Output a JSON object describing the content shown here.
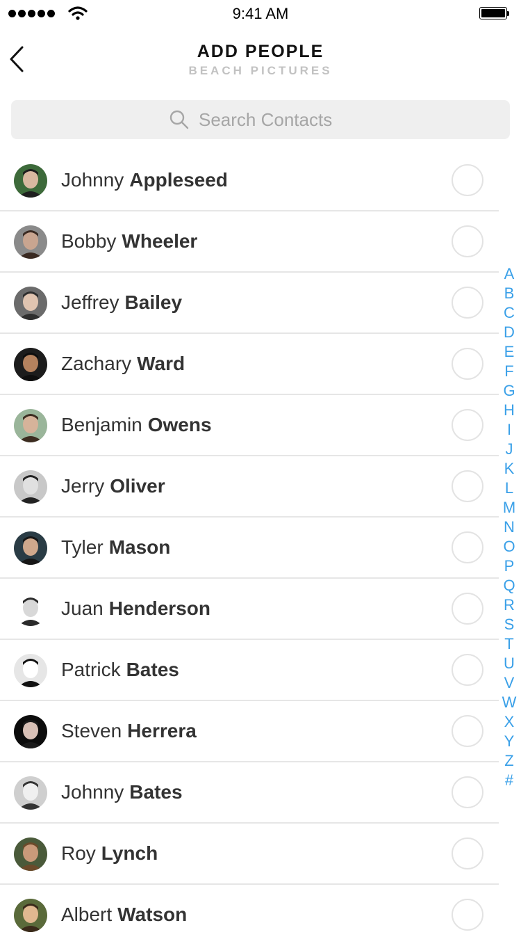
{
  "status_bar": {
    "time": "9:41 AM"
  },
  "nav": {
    "title": "ADD PEOPLE",
    "subtitle": "BEACH PICTURES"
  },
  "search": {
    "placeholder": "Search Contacts",
    "value": ""
  },
  "contacts": [
    {
      "first": "Johnny",
      "last": "Appleseed"
    },
    {
      "first": "Bobby",
      "last": "Wheeler"
    },
    {
      "first": "Jeffrey",
      "last": "Bailey"
    },
    {
      "first": "Zachary",
      "last": "Ward"
    },
    {
      "first": "Benjamin",
      "last": "Owens"
    },
    {
      "first": "Jerry",
      "last": "Oliver"
    },
    {
      "first": "Tyler",
      "last": "Mason"
    },
    {
      "first": "Juan",
      "last": "Henderson"
    },
    {
      "first": "Patrick",
      "last": "Bates"
    },
    {
      "first": "Steven",
      "last": "Herrera"
    },
    {
      "first": "Johnny",
      "last": "Bates"
    },
    {
      "first": "Roy",
      "last": "Lynch"
    },
    {
      "first": "Albert",
      "last": "Watson"
    }
  ],
  "index_letters": [
    "A",
    "B",
    "C",
    "D",
    "E",
    "F",
    "G",
    "H",
    "I",
    "J",
    "K",
    "L",
    "M",
    "N",
    "O",
    "P",
    "Q",
    "R",
    "S",
    "T",
    "U",
    "V",
    "W",
    "X",
    "Y",
    "Z",
    "#"
  ],
  "colors": {
    "accent": "#3aa0e8",
    "separator": "#e6e6e6"
  }
}
